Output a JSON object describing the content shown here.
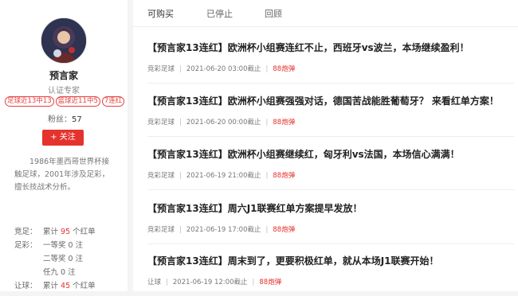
{
  "profile": {
    "name": "预言家",
    "role": "认证专家",
    "tags": [
      "足球近13中13",
      "篮球近11中5",
      "7连红"
    ],
    "fans_label": "粉丝：",
    "fans_count": "57",
    "follow_label": "+ 关注",
    "bio": "1986年墨西哥世界杯接触足球，2001年涉及足彩，擅长技战术分析。"
  },
  "stats": [
    {
      "label": "竞足：",
      "prefix": "累计 ",
      "value": "95",
      "suffix": " 个红单",
      "red": true
    },
    {
      "label": "足彩：",
      "prefix": "一等奖 ",
      "value": "0",
      "suffix": " 注",
      "red": false
    },
    {
      "label": "",
      "prefix": "二等奖 ",
      "value": "0",
      "suffix": " 注",
      "red": false
    },
    {
      "label": "",
      "prefix": "任九 ",
      "value": "0",
      "suffix": " 注",
      "red": false
    },
    {
      "label": "让球：",
      "prefix": "累计 ",
      "value": "45",
      "suffix": " 个红单",
      "red": true
    }
  ],
  "tabs": [
    "可购买",
    "已停止",
    "回顾"
  ],
  "articles": [
    {
      "title": "【预言家13连红】欧洲杯小组赛连红不止，西班牙vs波兰，本场继续盈利！",
      "category": "竞彩足球",
      "time": "2021-06-20 03:00截止",
      "price": "88炮弹"
    },
    {
      "title": "【预言家13连红】欧洲杯小组赛强强对话，德国苦战能胜葡萄牙？ 来看红单方案！",
      "category": "竞彩足球",
      "time": "2021-06-20 00:00截止",
      "price": "88炮弹"
    },
    {
      "title": "【预言家13连红】欧洲杯小组赛继续红，匈牙利vs法国，本场信心满满！",
      "category": "竞彩足球",
      "time": "2021-06-19 21:00截止",
      "price": "88炮弹"
    },
    {
      "title": "【预言家13连红】周六J1联赛红单方案提早发放！",
      "category": "竞彩足球",
      "time": "2021-06-19 17:00截止",
      "price": "88炮弹"
    },
    {
      "title": "【预言家13连红】周末到了，更要积极红单，就从本场J1联赛开始！",
      "category": "让球",
      "time": "2021-06-19 12:00截止",
      "price": "88炮弹"
    }
  ]
}
